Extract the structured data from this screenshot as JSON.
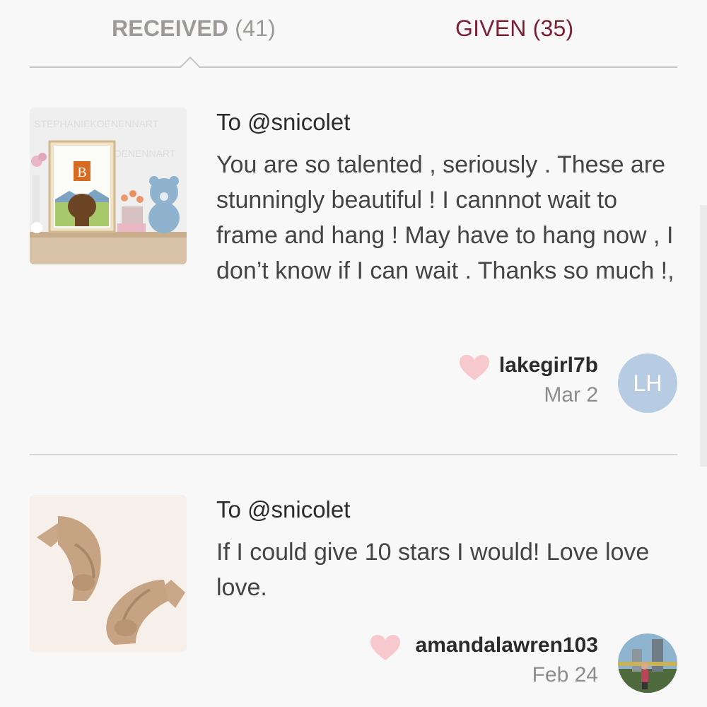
{
  "tabs": {
    "received_label": "RECEIVED",
    "received_count": "(41)",
    "given_label": "GIVEN",
    "given_count": "(35)"
  },
  "colors": {
    "accent": "#7a2136",
    "heart": "#f7c9ce",
    "avatar_initials_bg": "#b7cbe3"
  },
  "reviews": [
    {
      "recipient": "To @snicolet",
      "message": "You are so talented , seriously . These are stunningly beautiful ! I cannnot wait to frame and hang ! May have to hang now , I don’t know if I can wait . Thanks so much !,",
      "author": "lakegirl7b",
      "date": "Mar 2",
      "avatar_initials": "LH",
      "thumb": {
        "watermark": "STEPHANIEKOENENNART",
        "poster_letter": "B"
      },
      "heart_icon": "heart-icon"
    },
    {
      "recipient": "To @snicolet",
      "message": "If I could give 10 stars I would! Love love love.",
      "author": "amandalawren103",
      "date": "Feb 24",
      "heart_icon": "heart-icon"
    }
  ]
}
